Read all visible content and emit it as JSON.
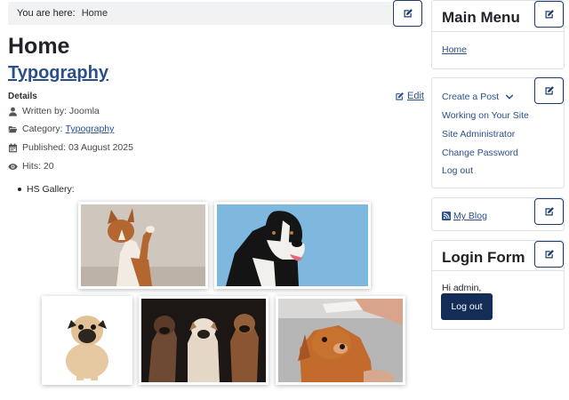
{
  "breadcrumb": {
    "prefix": "You are here:",
    "home": "Home"
  },
  "page_title": "Home",
  "article": {
    "title": "Typography",
    "details_label": "Details",
    "edit_label": "Edit",
    "written_by": "Written by: Joomla",
    "category_prefix": "Category:",
    "category_link": "Typography",
    "published": "Published: 03 August 2025",
    "hits": "Hits: 20",
    "gallery_label": "HS Gallery:"
  },
  "sidebar": {
    "main_menu": {
      "title": "Main Menu",
      "home_link": "Home"
    },
    "user_menu": {
      "items": [
        "Create a Post",
        "Working on Your Site",
        "Site Administrator",
        "Change Password",
        "Log out"
      ]
    },
    "blog": {
      "link": "My Blog"
    },
    "login": {
      "title": "Login Form",
      "greeting": "Hi admin,",
      "logout_button": "Log out"
    }
  },
  "colors": {
    "accent": "#2a4f8a",
    "button_dark": "#132d57",
    "edit_border": "#1d3a6b"
  },
  "icons": [
    "edit-icon",
    "user-icon",
    "folder-icon",
    "calendar-icon",
    "eye-icon",
    "rss-icon",
    "chevron-down-icon"
  ]
}
